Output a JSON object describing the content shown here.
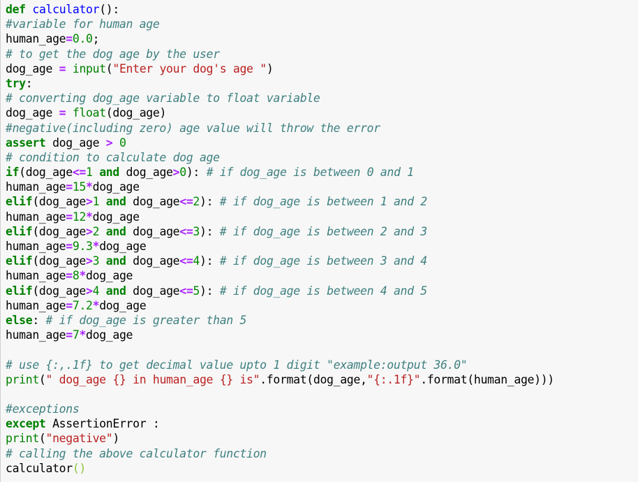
{
  "editor": {
    "language": "python",
    "lines": [
      [
        {
          "t": "def",
          "c": "kw"
        },
        {
          "t": " ",
          "c": "plain"
        },
        {
          "t": "calculator",
          "c": "def"
        },
        {
          "t": "():",
          "c": "plain"
        }
      ],
      [
        {
          "t": "#variable for human age",
          "c": "cm"
        }
      ],
      [
        {
          "t": "human_age",
          "c": "plain"
        },
        {
          "t": "=",
          "c": "op"
        },
        {
          "t": "0.0",
          "c": "num"
        },
        {
          "t": ";",
          "c": "plain"
        }
      ],
      [
        {
          "t": "# to get the dog age by the user",
          "c": "cm"
        }
      ],
      [
        {
          "t": "dog_age ",
          "c": "plain"
        },
        {
          "t": "=",
          "c": "op"
        },
        {
          "t": " ",
          "c": "plain"
        },
        {
          "t": "input",
          "c": "bi"
        },
        {
          "t": "(",
          "c": "plain"
        },
        {
          "t": "\"Enter your dog's age \"",
          "c": "str"
        },
        {
          "t": ")",
          "c": "plain"
        }
      ],
      [
        {
          "t": "try",
          "c": "kw"
        },
        {
          "t": ":",
          "c": "plain"
        }
      ],
      [
        {
          "t": "# converting dog_age variable to float variable",
          "c": "cm"
        }
      ],
      [
        {
          "t": "dog_age ",
          "c": "plain"
        },
        {
          "t": "=",
          "c": "op"
        },
        {
          "t": " ",
          "c": "plain"
        },
        {
          "t": "float",
          "c": "bi"
        },
        {
          "t": "(dog_age)",
          "c": "plain"
        }
      ],
      [
        {
          "t": "#negative(including zero) age value will throw the error",
          "c": "cm"
        }
      ],
      [
        {
          "t": "assert",
          "c": "kw"
        },
        {
          "t": " dog_age ",
          "c": "plain"
        },
        {
          "t": ">",
          "c": "op"
        },
        {
          "t": " ",
          "c": "plain"
        },
        {
          "t": "0",
          "c": "num"
        }
      ],
      [
        {
          "t": "# condition to calculate dog age",
          "c": "cm"
        }
      ],
      [
        {
          "t": "if",
          "c": "kw"
        },
        {
          "t": "(dog_age",
          "c": "plain"
        },
        {
          "t": "<=",
          "c": "op"
        },
        {
          "t": "1",
          "c": "num"
        },
        {
          "t": " ",
          "c": "plain"
        },
        {
          "t": "and",
          "c": "kw"
        },
        {
          "t": " dog_age",
          "c": "plain"
        },
        {
          "t": ">",
          "c": "op"
        },
        {
          "t": "0",
          "c": "num"
        },
        {
          "t": "): ",
          "c": "plain"
        },
        {
          "t": "# if dog_age is between 0 and 1",
          "c": "cm"
        }
      ],
      [
        {
          "t": "human_age",
          "c": "plain"
        },
        {
          "t": "=",
          "c": "op"
        },
        {
          "t": "15",
          "c": "num"
        },
        {
          "t": "*",
          "c": "op"
        },
        {
          "t": "dog_age",
          "c": "plain"
        }
      ],
      [
        {
          "t": "elif",
          "c": "kw"
        },
        {
          "t": "(dog_age",
          "c": "plain"
        },
        {
          "t": ">",
          "c": "op"
        },
        {
          "t": "1",
          "c": "num"
        },
        {
          "t": " ",
          "c": "plain"
        },
        {
          "t": "and",
          "c": "kw"
        },
        {
          "t": " dog_age",
          "c": "plain"
        },
        {
          "t": "<=",
          "c": "op"
        },
        {
          "t": "2",
          "c": "num"
        },
        {
          "t": "): ",
          "c": "plain"
        },
        {
          "t": "# if dog_age is between 1 and 2",
          "c": "cm"
        }
      ],
      [
        {
          "t": "human_age",
          "c": "plain"
        },
        {
          "t": "=",
          "c": "op"
        },
        {
          "t": "12",
          "c": "num"
        },
        {
          "t": "*",
          "c": "op"
        },
        {
          "t": "dog_age",
          "c": "plain"
        }
      ],
      [
        {
          "t": "elif",
          "c": "kw"
        },
        {
          "t": "(dog_age",
          "c": "plain"
        },
        {
          "t": ">",
          "c": "op"
        },
        {
          "t": "2",
          "c": "num"
        },
        {
          "t": " ",
          "c": "plain"
        },
        {
          "t": "and",
          "c": "kw"
        },
        {
          "t": " dog_age",
          "c": "plain"
        },
        {
          "t": "<=",
          "c": "op"
        },
        {
          "t": "3",
          "c": "num"
        },
        {
          "t": "): ",
          "c": "plain"
        },
        {
          "t": "# if dog_age is between 2 and 3",
          "c": "cm"
        }
      ],
      [
        {
          "t": "human_age",
          "c": "plain"
        },
        {
          "t": "=",
          "c": "op"
        },
        {
          "t": "9.3",
          "c": "num"
        },
        {
          "t": "*",
          "c": "op"
        },
        {
          "t": "dog_age",
          "c": "plain"
        }
      ],
      [
        {
          "t": "elif",
          "c": "kw"
        },
        {
          "t": "(dog_age",
          "c": "plain"
        },
        {
          "t": ">",
          "c": "op"
        },
        {
          "t": "3",
          "c": "num"
        },
        {
          "t": " ",
          "c": "plain"
        },
        {
          "t": "and",
          "c": "kw"
        },
        {
          "t": " dog_age",
          "c": "plain"
        },
        {
          "t": "<=",
          "c": "op"
        },
        {
          "t": "4",
          "c": "num"
        },
        {
          "t": "): ",
          "c": "plain"
        },
        {
          "t": "# if dog_age is between 3 and 4",
          "c": "cm"
        }
      ],
      [
        {
          "t": "human_age",
          "c": "plain"
        },
        {
          "t": "=",
          "c": "op"
        },
        {
          "t": "8",
          "c": "num"
        },
        {
          "t": "*",
          "c": "op"
        },
        {
          "t": "dog_age",
          "c": "plain"
        }
      ],
      [
        {
          "t": "elif",
          "c": "kw"
        },
        {
          "t": "(dog_age",
          "c": "plain"
        },
        {
          "t": ">",
          "c": "op"
        },
        {
          "t": "4",
          "c": "num"
        },
        {
          "t": " ",
          "c": "plain"
        },
        {
          "t": "and",
          "c": "kw"
        },
        {
          "t": " dog_age",
          "c": "plain"
        },
        {
          "t": "<=",
          "c": "op"
        },
        {
          "t": "5",
          "c": "num"
        },
        {
          "t": "): ",
          "c": "plain"
        },
        {
          "t": "# if dog_age is between 4 and 5",
          "c": "cm"
        }
      ],
      [
        {
          "t": "human_age",
          "c": "plain"
        },
        {
          "t": "=",
          "c": "op"
        },
        {
          "t": "7.2",
          "c": "num"
        },
        {
          "t": "*",
          "c": "op"
        },
        {
          "t": "dog_age",
          "c": "plain"
        }
      ],
      [
        {
          "t": "else",
          "c": "kw"
        },
        {
          "t": ": ",
          "c": "plain"
        },
        {
          "t": "# if dog_age is greater than 5",
          "c": "cm"
        }
      ],
      [
        {
          "t": "human_age",
          "c": "plain"
        },
        {
          "t": "=",
          "c": "op"
        },
        {
          "t": "7",
          "c": "num"
        },
        {
          "t": "*",
          "c": "op"
        },
        {
          "t": "dog_age",
          "c": "plain"
        }
      ],
      [],
      [
        {
          "t": "# use {:,.1f} to get decimal value upto 1 digit \"example:output 36.0\"",
          "c": "cm"
        }
      ],
      [
        {
          "t": "print",
          "c": "bi"
        },
        {
          "t": "(",
          "c": "plain"
        },
        {
          "t": "\" dog_age {} in human_age {} is\"",
          "c": "str"
        },
        {
          "t": ".format(dog_age,",
          "c": "plain"
        },
        {
          "t": "\"{:.1f}\"",
          "c": "str"
        },
        {
          "t": ".format(human_age)))",
          "c": "plain"
        }
      ],
      [],
      [
        {
          "t": "#exceptions",
          "c": "cm"
        }
      ],
      [
        {
          "t": "except",
          "c": "kw"
        },
        {
          "t": " AssertionError :",
          "c": "plain"
        }
      ],
      [
        {
          "t": "print",
          "c": "bi"
        },
        {
          "t": "(",
          "c": "plain"
        },
        {
          "t": "\"negative\"",
          "c": "str"
        },
        {
          "t": ")",
          "c": "plain"
        }
      ],
      [
        {
          "t": "# calling the above calculator function",
          "c": "cm"
        }
      ],
      [
        {
          "t": "calculator",
          "c": "plain"
        },
        {
          "t": "()",
          "c": "gparen"
        }
      ]
    ]
  },
  "colors": {
    "background": "#f7f7f7",
    "keyword": "#008000",
    "function_name": "#0000ff",
    "comment": "#408080",
    "operator": "#aa22ff",
    "number": "#008800",
    "string": "#ba2121"
  }
}
